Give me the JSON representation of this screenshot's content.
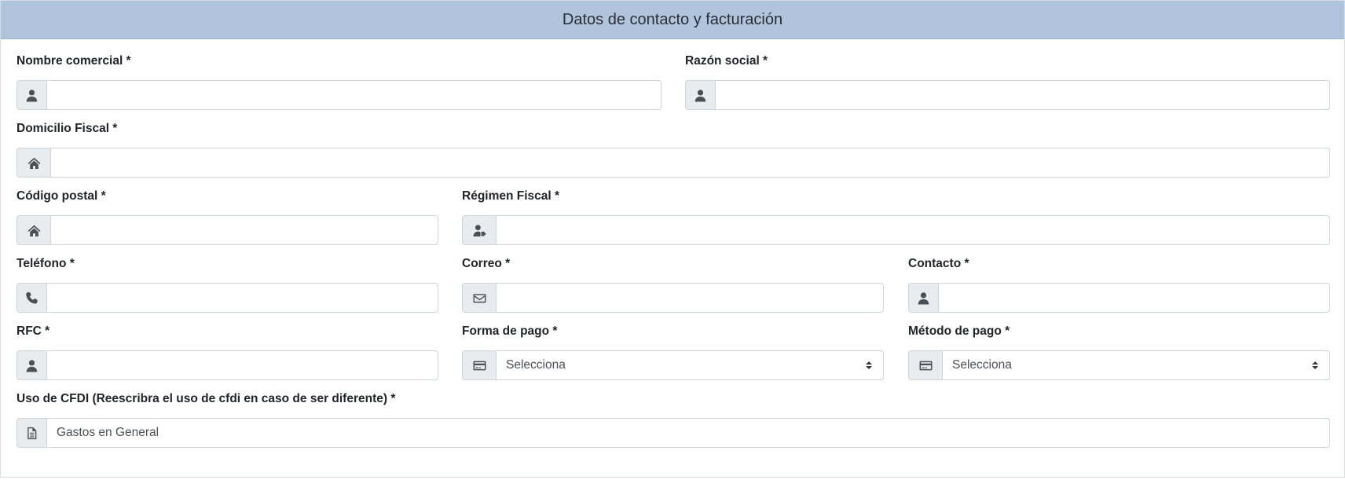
{
  "header": {
    "title": "Datos de contacto y facturación"
  },
  "fields": {
    "nombre_comercial": {
      "label": "Nombre comercial *",
      "value": "",
      "icon": "user-icon"
    },
    "razon_social": {
      "label": "Razón social *",
      "value": "",
      "icon": "user-icon"
    },
    "domicilio_fiscal": {
      "label": "Domicilio Fiscal *",
      "value": "",
      "icon": "home-icon"
    },
    "codigo_postal": {
      "label": "Código postal *",
      "value": "",
      "icon": "home-icon"
    },
    "regimen_fiscal": {
      "label": "Régimen Fiscal *",
      "value": "",
      "icon": "user-tag-icon"
    },
    "telefono": {
      "label": "Teléfono *",
      "value": "",
      "icon": "phone-icon"
    },
    "correo": {
      "label": "Correo *",
      "value": "",
      "icon": "envelope-icon"
    },
    "contacto": {
      "label": "Contacto *",
      "value": "",
      "icon": "user-icon"
    },
    "rfc": {
      "label": "RFC *",
      "value": "",
      "icon": "user-icon"
    },
    "forma_pago": {
      "label": "Forma de pago *",
      "selected": "Selecciona",
      "icon": "credit-card-icon"
    },
    "metodo_pago": {
      "label": "Método de pago *",
      "selected": "Selecciona",
      "icon": "credit-card-icon"
    },
    "uso_cfdi": {
      "label": "Uso de CFDI (Reescribra el uso de cfdi en caso de ser diferente) *",
      "value": "Gastos en General",
      "icon": "file-icon"
    }
  }
}
